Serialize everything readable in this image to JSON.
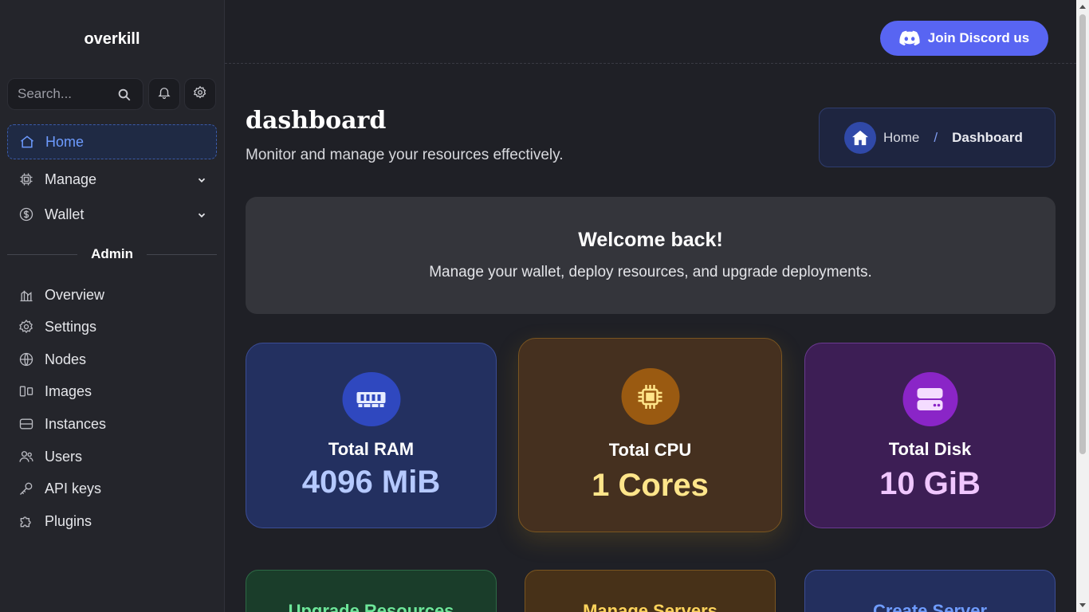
{
  "app": {
    "brand": "overkill"
  },
  "sidebar": {
    "search_placeholder": "Search...",
    "nav": [
      {
        "label": "Home",
        "icon": "home-icon",
        "active": true
      },
      {
        "label": "Manage",
        "icon": "chip-icon"
      },
      {
        "label": "Wallet",
        "icon": "dollar-icon"
      }
    ],
    "admin_heading": "Admin",
    "admin": [
      {
        "label": "Overview",
        "icon": "chart-icon"
      },
      {
        "label": "Settings",
        "icon": "gear-icon"
      },
      {
        "label": "Nodes",
        "icon": "globe-icon"
      },
      {
        "label": "Images",
        "icon": "images-icon"
      },
      {
        "label": "Instances",
        "icon": "server-icon"
      },
      {
        "label": "Users",
        "icon": "users-icon"
      },
      {
        "label": "API keys",
        "icon": "key-icon"
      },
      {
        "label": "Plugins",
        "icon": "puzzle-icon"
      }
    ]
  },
  "header": {
    "discord_label": "Join Discord us"
  },
  "page": {
    "title": "dashboard",
    "subtitle": "Monitor and manage your resources effectively.",
    "breadcrumb": {
      "home": "Home",
      "separator": "/",
      "current": "Dashboard"
    }
  },
  "welcome": {
    "title": "Welcome back!",
    "text": "Manage your wallet, deploy resources, and upgrade deployments."
  },
  "stats": {
    "ram": {
      "label": "Total RAM",
      "value": "4096 MiB"
    },
    "cpu": {
      "label": "Total CPU",
      "value": "1 Cores"
    },
    "disk": {
      "label": "Total Disk",
      "value": "10 GiB"
    }
  },
  "actions": {
    "upgrade": "Upgrade Resources",
    "manage": "Manage Servers",
    "create": "Create Server"
  },
  "colors": {
    "accent": "#5865f2",
    "active_nav": "#6d9bff",
    "ram_value": "#b5c9ff",
    "cpu_value": "#ffe58a",
    "disk_value": "#f0c6ff"
  }
}
